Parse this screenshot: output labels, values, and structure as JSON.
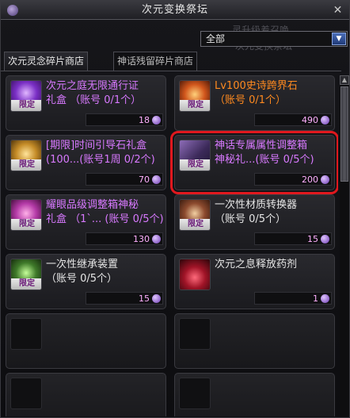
{
  "title": "次元变换祭坛",
  "header": {
    "ghost_text_1": "灵升级着召唤",
    "ghost_text_2": "次元变换祭坛",
    "dropdown_value": "全部",
    "dropdown_arrow": "▼"
  },
  "tabs": [
    {
      "label": "次元灵念碎片商店",
      "active": true
    },
    {
      "label": "神话残留碎片商店",
      "active": false
    }
  ],
  "scroll_up_glyph": "▲",
  "close_glyph": "✕",
  "items": [
    {
      "name": "次元之庭无限通行证",
      "limit": "礼盒 （账号 0/1个）",
      "price": "18",
      "badge": "限定",
      "icon": "purple-orb-icon",
      "color": "purple"
    },
    {
      "name": "Lv100史诗跨界石",
      "limit": "（账号 0/1个）",
      "price": "490",
      "badge": "限定",
      "icon": "epic-stone-icon",
      "color": "orange"
    },
    {
      "name": "[期限]时间引导石礼盒",
      "limit": "(100...(账号1周 0/2个)",
      "price": "70",
      "badge": "限定",
      "icon": "gold-stone-box-icon",
      "color": "purple"
    },
    {
      "name": "神话专属属性调整箱",
      "limit": "神秘礼...(账号 0/5个)",
      "price": "200",
      "badge": "限定",
      "icon": "mythic-box-icon",
      "color": "purple"
    },
    {
      "name": "耀眼品级调整箱神秘",
      "limit": "礼盒 （1`... (账号 0/5个)",
      "price": "130",
      "badge": "限定",
      "icon": "pink-box-icon",
      "color": "purple"
    },
    {
      "name": "一次性材质转换器",
      "limit": "（账号 0/5个）",
      "price": "15",
      "badge": "限定",
      "icon": "material-converter-icon",
      "color": "white"
    },
    {
      "name": "一次性继承装置",
      "limit": "（账号 0/5个）",
      "price": "15",
      "badge": "限定",
      "icon": "inherit-device-icon",
      "color": "white"
    },
    {
      "name": "次元之息释放药剂",
      "limit": "",
      "price": "1",
      "badge": "",
      "icon": "potion-icon",
      "color": "white"
    }
  ]
}
